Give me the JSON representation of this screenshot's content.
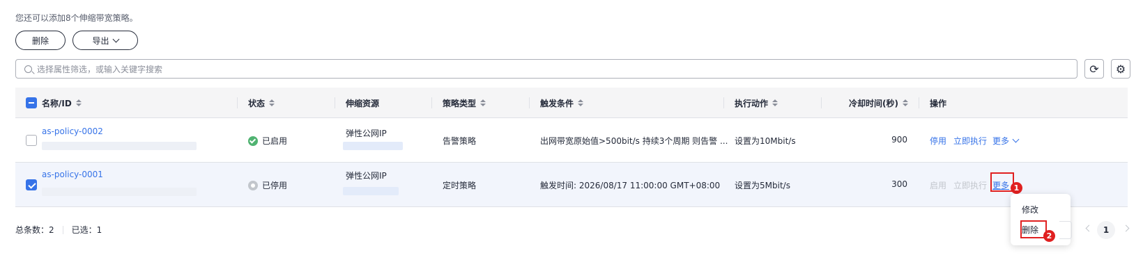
{
  "tip": "您还可以添加8个伸缩带宽策略。",
  "toolbar": {
    "delete_label": "删除",
    "export_label": "导出"
  },
  "search": {
    "placeholder": "选择属性筛选，或输入关键字搜索"
  },
  "icons": {
    "refresh": "refresh-icon",
    "settings": "gear-icon"
  },
  "columns": {
    "name": "名称/ID",
    "status": "状态",
    "resource": "伸缩资源",
    "policy_type": "策略类型",
    "trigger": "触发条件",
    "action": "执行动作",
    "cooldown": "冷却时间(秒)",
    "operations": "操作"
  },
  "rows": [
    {
      "name": "as-policy-0002",
      "selected": false,
      "status": "已启用",
      "resource": "弹性公网IP",
      "policy_type": "告警策略",
      "trigger": "出网带宽原始值>500bit/s 持续3个周期 则告警 ...",
      "action": "设置为10Mbit/s",
      "cooldown": "900",
      "ops": {
        "enable": "停用",
        "execute": "立即执行",
        "more": "更多"
      }
    },
    {
      "name": "as-policy-0001",
      "selected": true,
      "status": "已停用",
      "resource": "弹性公网IP",
      "policy_type": "定时策略",
      "trigger": "触发时间: 2026/08/17 11:00:00 GMT+08:00",
      "action": "设置为5Mbit/s",
      "cooldown": "300",
      "ops": {
        "enable": "启用",
        "execute": "立即执行",
        "more": "更多"
      }
    }
  ],
  "dropdown": {
    "items": [
      "修改",
      "删除"
    ]
  },
  "annotations": {
    "badge1": "1",
    "badge2": "2"
  },
  "footer": {
    "total": "总条数：2",
    "selected": "已选：1"
  },
  "pagination": {
    "current": "1"
  },
  "colors": {
    "accent": "#3673e8",
    "annotation_red": "#e02020",
    "success": "#50b371"
  }
}
